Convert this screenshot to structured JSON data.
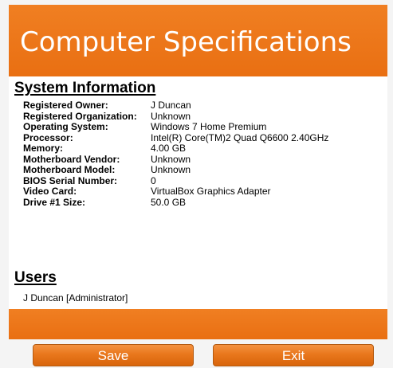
{
  "header": {
    "title": "Computer Specifications"
  },
  "system_information": {
    "title": "System Information",
    "rows": [
      {
        "label": "Registered Owner:",
        "value": "J Duncan"
      },
      {
        "label": "Registered Organization:",
        "value": "Unknown"
      },
      {
        "label": "Operating System:",
        "value": "Windows 7 Home Premium"
      },
      {
        "label": "Processor:",
        "value": "Intel(R) Core(TM)2 Quad Q6600 2.40GHz"
      },
      {
        "label": "Memory:",
        "value": "4.00 GB"
      },
      {
        "label": "Motherboard Vendor:",
        "value": "Unknown"
      },
      {
        "label": "Motherboard Model:",
        "value": "Unknown"
      },
      {
        "label": "BIOS Serial Number:",
        "value": "0"
      },
      {
        "label": "Video Card:",
        "value": "VirtualBox Graphics Adapter"
      },
      {
        "label": "Drive #1 Size:",
        "value": "50.0 GB"
      }
    ]
  },
  "users": {
    "title": "Users",
    "items": [
      "J Duncan [Administrator]"
    ]
  },
  "footer": {
    "save_label": "Save",
    "exit_label": "Exit"
  },
  "colors": {
    "accent_orange": "#ee7a1c",
    "button_text": "#ffffff"
  }
}
